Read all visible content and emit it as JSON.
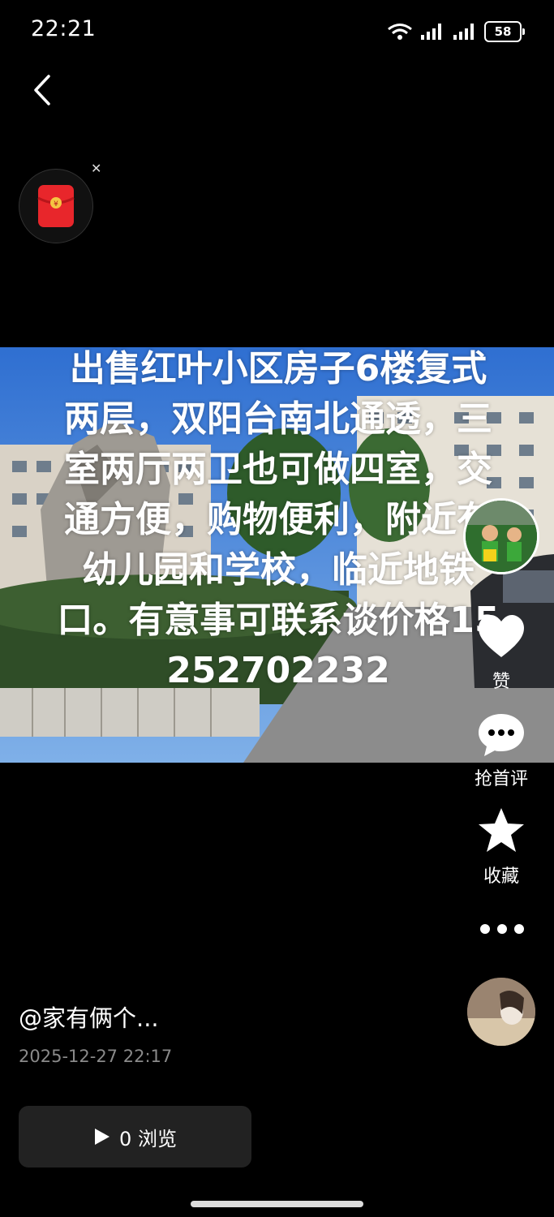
{
  "status_bar": {
    "time": "22:21",
    "battery": "58"
  },
  "post": {
    "caption": "出售红叶小区房子6楼复式两层，双阳台南北通透，三室两厅两卫也可做四室，交通方便，购物便利，附近有幼儿园和学校，临近地铁口。有意事可联系谈价格15252702232",
    "author": "@家有俩个...",
    "date": "2025-12-27 22:17",
    "views_label": "0 浏览"
  },
  "actions": {
    "like": "赞",
    "comment": "抢首评",
    "favorite": "收藏"
  },
  "colors": {
    "background": "#000000",
    "views_button": "#222222",
    "date_text": "#8a8a8a",
    "red_packet": "#e8262b"
  }
}
